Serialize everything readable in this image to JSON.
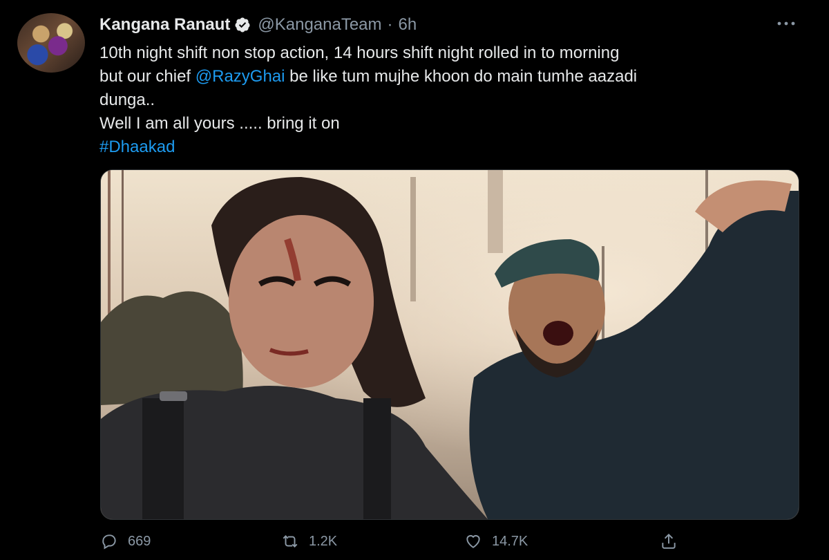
{
  "tweet": {
    "author_name": "Kangana Ranaut",
    "author_handle": "@KanganaTeam",
    "separator": "·",
    "time": "6h",
    "text_lines": [
      {
        "plain": "10th night shift non stop action, 14 hours shift night rolled in to morning"
      },
      {
        "before": "but our chief ",
        "mention": "@RazyGhai",
        "after": " be like tum mujhe khoon do main tumhe aazadi"
      },
      {
        "plain": "dunga.."
      },
      {
        "plain": "Well I am all yours ..... bring it on"
      }
    ],
    "hashtag": "#Dhaakad"
  },
  "actions": {
    "reply_count": "669",
    "retweet_count": "1.2K",
    "like_count": "14.7K"
  },
  "icons": [
    "more-icon",
    "verified-icon",
    "reply-icon",
    "retweet-icon",
    "like-icon",
    "share-icon"
  ],
  "colors": {
    "background": "#000000",
    "text": "#e7e9ea",
    "muted": "#8b98a5",
    "link": "#1d9bf0"
  }
}
